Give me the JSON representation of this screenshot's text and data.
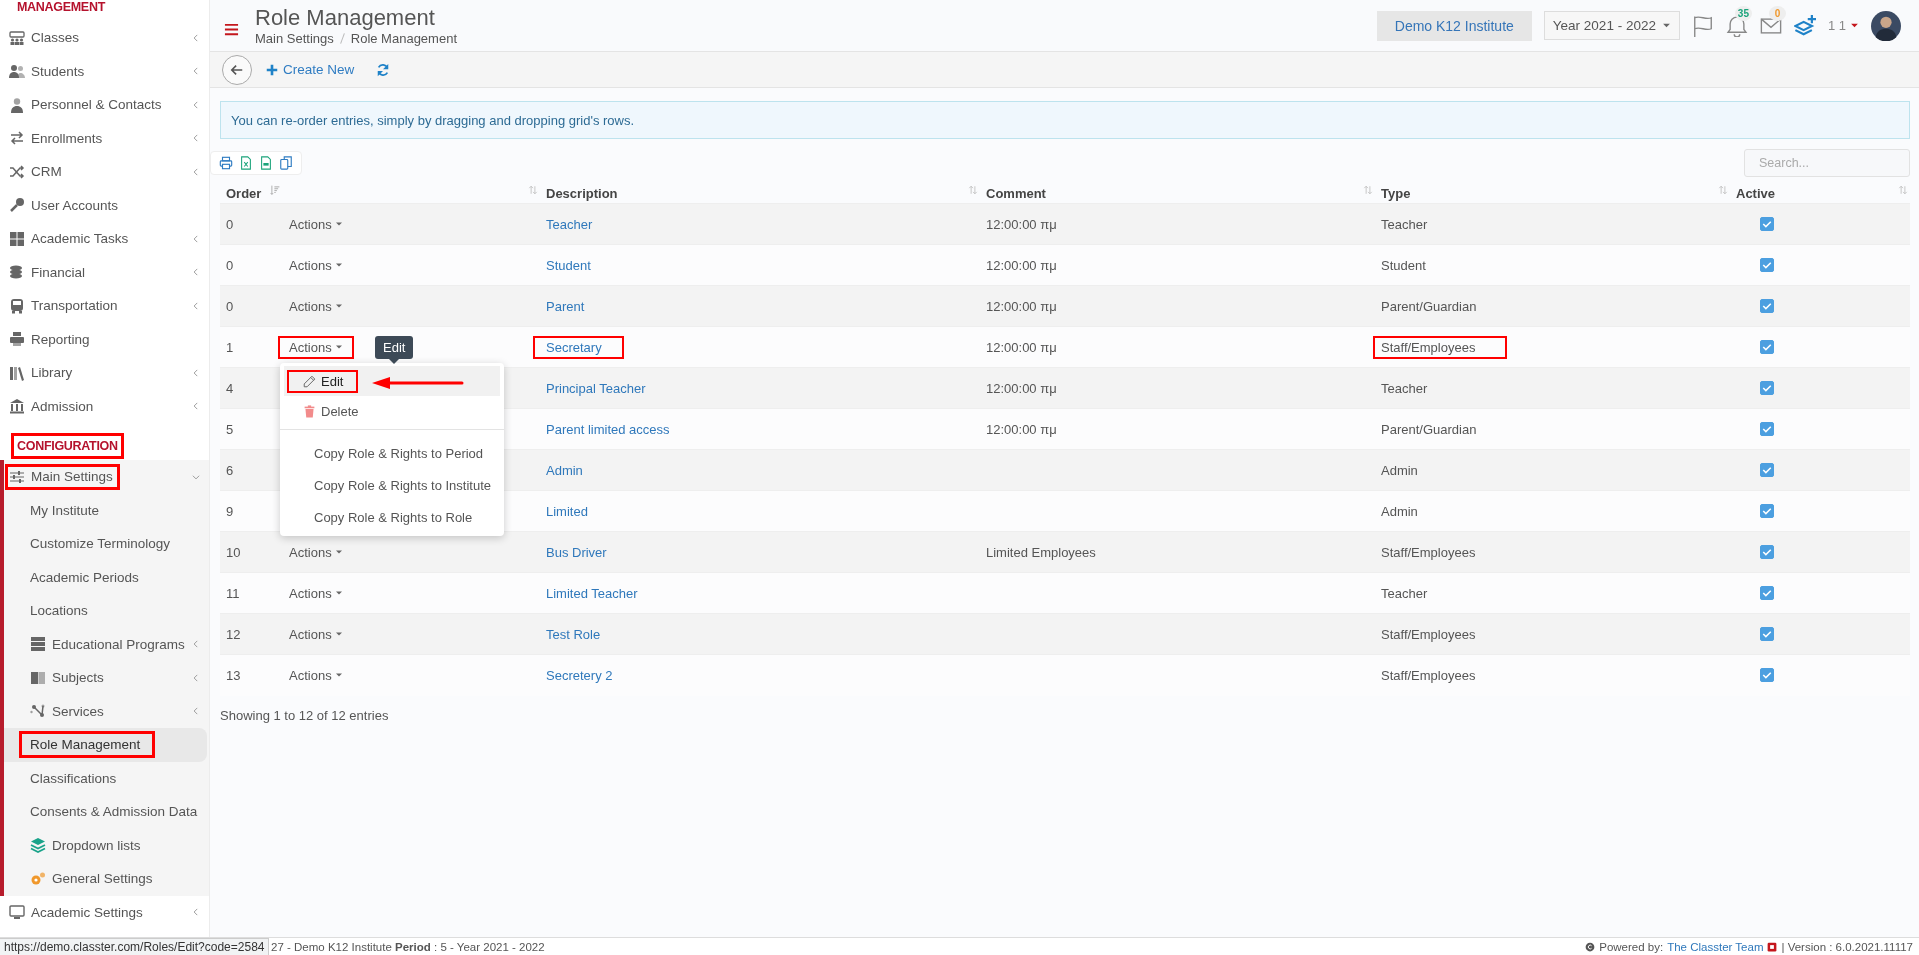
{
  "sidebar": {
    "sections": [
      {
        "heading": "MANAGEMENT",
        "highlighted": false,
        "items": [
          {
            "label": "Classes",
            "expandable": true,
            "expanded": false,
            "highlighted": false
          },
          {
            "label": "Students",
            "expandable": true,
            "expanded": false,
            "highlighted": false
          },
          {
            "label": "Personnel & Contacts",
            "expandable": true,
            "expanded": false,
            "highlighted": false
          },
          {
            "label": "Enrollments",
            "expandable": true,
            "expanded": false,
            "highlighted": false
          },
          {
            "label": "CRM",
            "expandable": true,
            "expanded": false,
            "highlighted": false
          },
          {
            "label": "User Accounts",
            "expandable": false,
            "highlighted": false
          },
          {
            "label": "Academic Tasks",
            "expandable": true,
            "expanded": false,
            "highlighted": false
          },
          {
            "label": "Financial",
            "expandable": true,
            "expanded": false,
            "highlighted": false
          },
          {
            "label": "Transportation",
            "expandable": true,
            "expanded": false,
            "highlighted": false
          },
          {
            "label": "Reporting",
            "expandable": false,
            "highlighted": false
          },
          {
            "label": "Library",
            "expandable": true,
            "expanded": false,
            "highlighted": false
          },
          {
            "label": "Admission",
            "expandable": true,
            "expanded": false,
            "highlighted": false
          }
        ]
      },
      {
        "heading": "CONFIGURATION",
        "highlighted": true,
        "items": [
          {
            "label": "Main Settings",
            "expandable": true,
            "expanded": true,
            "highlighted": true,
            "children": [
              {
                "label": "My Institute",
                "expandable": false,
                "selected": false,
                "highlighted": false
              },
              {
                "label": "Customize Terminology",
                "expandable": false,
                "selected": false,
                "highlighted": false
              },
              {
                "label": "Academic Periods",
                "expandable": false,
                "selected": false,
                "highlighted": false
              },
              {
                "label": "Locations",
                "expandable": false,
                "selected": false,
                "highlighted": false
              },
              {
                "label": "Educational Programs",
                "expandable": true,
                "selected": false,
                "highlighted": false
              },
              {
                "label": "Subjects",
                "expandable": true,
                "selected": false,
                "highlighted": false
              },
              {
                "label": "Services",
                "expandable": true,
                "selected": false,
                "highlighted": false
              },
              {
                "label": "Role Management",
                "expandable": false,
                "selected": true,
                "highlighted": true
              },
              {
                "label": "Classifications",
                "expandable": false,
                "selected": false,
                "highlighted": false
              },
              {
                "label": "Consents & Admission Data",
                "expandable": false,
                "selected": false,
                "highlighted": false
              },
              {
                "label": "Dropdown lists",
                "expandable": false,
                "selected": false,
                "highlighted": false
              },
              {
                "label": "General Settings",
                "expandable": false,
                "selected": false,
                "highlighted": false
              }
            ]
          },
          {
            "label": "Academic Settings",
            "expandable": true,
            "expanded": false,
            "highlighted": false
          }
        ]
      }
    ]
  },
  "header": {
    "title": "Role Management",
    "breadcrumb": [
      "Main Settings",
      "Role Management"
    ],
    "institute": "Demo K12 Institute",
    "year": "Year 2021 - 2022",
    "notifications": "35",
    "messages": "0",
    "user": "1 1"
  },
  "toolbar": {
    "create": "Create New"
  },
  "alert": "You can re-order entries, simply by dragging and dropping grid's rows.",
  "search": {
    "placeholder": "Search..."
  },
  "table": {
    "columns": [
      {
        "label": "Order",
        "sorted": true
      },
      {
        "sorted": false
      },
      {
        "label": "Description",
        "sorted": false
      },
      {
        "label": "Comment",
        "sorted": false
      },
      {
        "label": "Type",
        "sorted": false
      },
      {
        "label": "Active",
        "sorted": false
      }
    ],
    "rows": [
      {
        "order": "0",
        "actions": "Actions",
        "description": "Teacher",
        "comment": "12:00:00 πμ",
        "type": "Teacher",
        "active": true,
        "menu_open": false,
        "highlighted": false
      },
      {
        "order": "0",
        "actions": "Actions",
        "description": "Student",
        "comment": "12:00:00 πμ",
        "type": "Student",
        "active": true,
        "menu_open": false,
        "highlighted": false
      },
      {
        "order": "0",
        "actions": "Actions",
        "description": "Parent",
        "comment": "12:00:00 πμ",
        "type": "Parent/Guardian",
        "active": true,
        "menu_open": false,
        "highlighted": false
      },
      {
        "order": "1",
        "actions": "Actions",
        "description": "Secretary",
        "comment": "12:00:00 πμ",
        "type": "Staff/Employees",
        "active": true,
        "menu_open": true,
        "highlighted": true
      },
      {
        "order": "4",
        "description": "Principal Teacher",
        "comment": "12:00:00 πμ",
        "type": "Teacher",
        "active": true,
        "highlighted": false
      },
      {
        "order": "5",
        "description": "Parent limited access",
        "comment": "12:00:00 πμ",
        "type": "Parent/Guardian",
        "active": true,
        "highlighted": false
      },
      {
        "order": "6",
        "description": "Admin",
        "type": "Admin",
        "active": true,
        "highlighted": false
      },
      {
        "order": "9",
        "description": "Limited",
        "type": "Admin",
        "active": true,
        "highlighted": false
      },
      {
        "order": "10",
        "actions": "Actions",
        "description": "Bus Driver",
        "comment": "Limited Employees",
        "type": "Staff/Employees",
        "active": true,
        "menu_open": false,
        "highlighted": false
      },
      {
        "order": "11",
        "actions": "Actions",
        "description": "Limited Teacher",
        "type": "Teacher",
        "active": true,
        "menu_open": false,
        "highlighted": false
      },
      {
        "order": "12",
        "actions": "Actions",
        "description": "Test Role",
        "type": "Staff/Employees",
        "active": true,
        "menu_open": false,
        "highlighted": false
      },
      {
        "order": "13",
        "actions": "Actions",
        "description": "Secretery 2",
        "type": "Staff/Employees",
        "active": true,
        "menu_open": false,
        "highlighted": false
      }
    ],
    "info": "Showing 1 to 12 of 12 entries"
  },
  "menu": {
    "tooltip": "Edit",
    "groups": [
      [
        {
          "label": "Edit",
          "hovered": true,
          "highlighted": true
        },
        {
          "label": "Delete",
          "hovered": false,
          "highlighted": false
        }
      ],
      [
        {
          "label": "Copy Role & Rights to Period",
          "hovered": false,
          "highlighted": false
        },
        {
          "label": "Copy Role & Rights to Institute",
          "hovered": false,
          "highlighted": false
        },
        {
          "label": "Copy Role & Rights to Role",
          "hovered": false,
          "highlighted": false
        }
      ]
    ]
  },
  "footer": {
    "url": "https://demo.classter.com/Roles/Edit?code=2584",
    "info": "27 - Demo K12 Institute **Period** : 5 - Year 2021 - 2022",
    "powered_by": "Powered by:",
    "team": "The Classter Team",
    "version": "| Version : 6.0.2021.11117"
  }
}
